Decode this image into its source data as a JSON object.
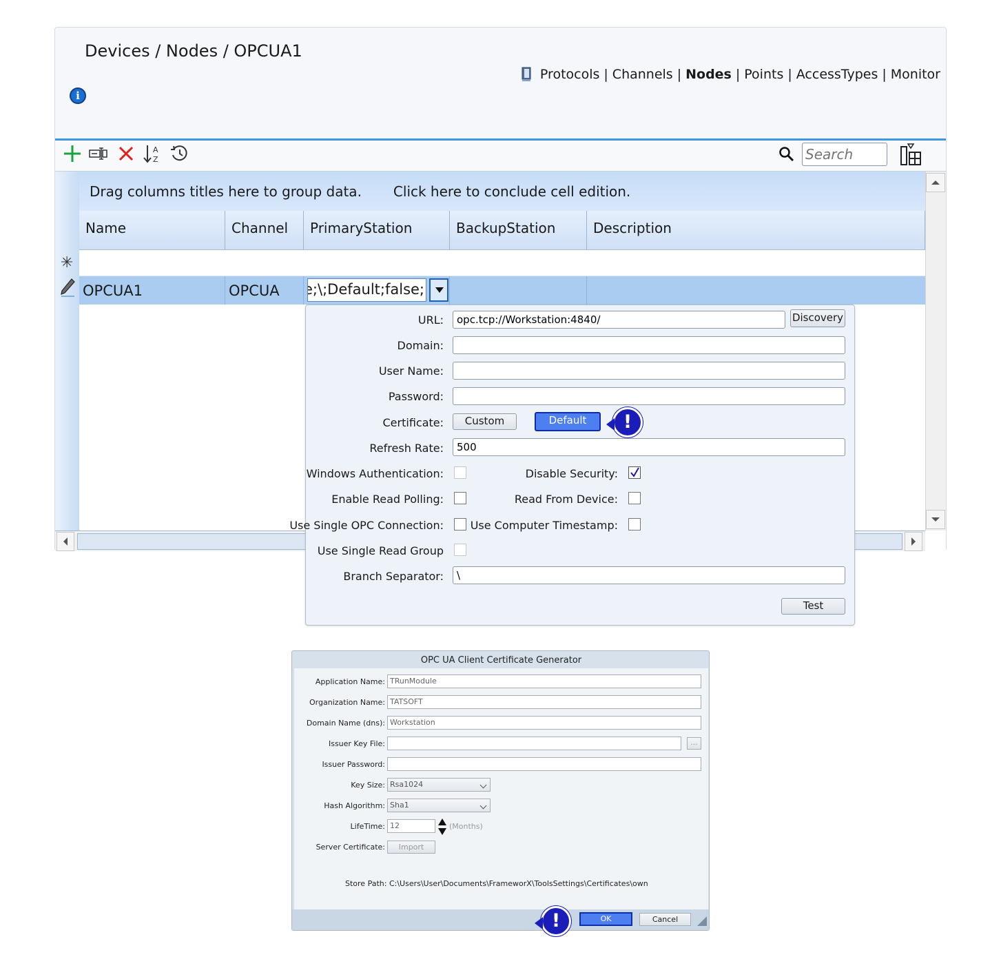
{
  "breadcrumb": "Devices / Nodes / OPCUA1",
  "top_nav": {
    "items": [
      "Protocols",
      "Channels",
      "Nodes",
      "Points",
      "AccessTypes",
      "Monitor"
    ],
    "active": "Nodes",
    "separator": "|"
  },
  "toolbar": {
    "icons": [
      "add-icon",
      "rename-icon",
      "delete-icon",
      "sort-az-icon",
      "history-icon"
    ],
    "search_placeholder": "Search"
  },
  "grid": {
    "group_hint": "Drag columns titles here to group data.",
    "conclude_hint": "Click here to conclude cell edition.",
    "columns": [
      "Name",
      "Channel",
      "PrimaryStation",
      "BackupStation",
      "Description"
    ],
    "rows": [
      {
        "name": "OPCUA1",
        "channel": "OPCUA",
        "primary_station": "ılse;\\;Default;false;",
        "backup_station": "",
        "description": ""
      }
    ]
  },
  "station_popup": {
    "url_label": "URL:",
    "url_value": "opc.tcp://Workstation:4840/",
    "discovery_label": "Discovery",
    "domain_label": "Domain:",
    "domain_value": "",
    "username_label": "User Name:",
    "username_value": "",
    "password_label": "Password:",
    "password_value": "",
    "certificate_label": "Certificate:",
    "custom_label": "Custom",
    "default_label": "Default",
    "refresh_label": "Refresh Rate:",
    "refresh_value": "500",
    "windows_auth_label": "Windows Authentication:",
    "windows_auth_checked": false,
    "disable_security_label": "Disable Security:",
    "disable_security_checked": true,
    "enable_read_polling_label": "Enable Read Polling:",
    "read_from_device_label": "Read From Device:",
    "single_opc_label": "Use Single OPC Connection:",
    "computer_timestamp_label": "Use Computer Timestamp:",
    "single_read_group_label": "Use Single Read Group",
    "branch_sep_label": "Branch Separator:",
    "branch_sep_value": "\\",
    "test_label": "Test"
  },
  "cert_dialog": {
    "title": "OPC UA Client Certificate Generator",
    "app_name_label": "Application Name:",
    "app_name_value": "TRunModule",
    "org_name_label": "Organization Name:",
    "org_name_value": "TATSOFT",
    "domain_label": "Domain Name (dns):",
    "domain_value": "Workstation",
    "issuer_key_label": "Issuer Key File:",
    "issuer_key_value": "",
    "browse_label": "...",
    "issuer_pwd_label": "Issuer Password:",
    "issuer_pwd_value": "",
    "key_size_label": "Key Size:",
    "key_size_value": "Rsa1024",
    "hash_label": "Hash Algorithm:",
    "hash_value": "Sha1",
    "lifetime_label": "LifeTime:",
    "lifetime_value": "12",
    "lifetime_unit": "(Months)",
    "server_cert_label": "Server Certificate:",
    "import_label": "Import",
    "store_path_label": "Store Path:",
    "store_path_value": "C:\\Users\\User\\Documents\\FrameworX\\ToolsSettings\\Certificates\\own",
    "ok_label": "OK",
    "cancel_label": "Cancel"
  },
  "callout_marks": [
    "!",
    "!"
  ],
  "colors": {
    "accent_blue": "#3e95e8",
    "selected_row": "#a9ccf0",
    "callout": "#1a1db8",
    "add_green": "#1aa33a",
    "delete_red": "#e0201b"
  }
}
